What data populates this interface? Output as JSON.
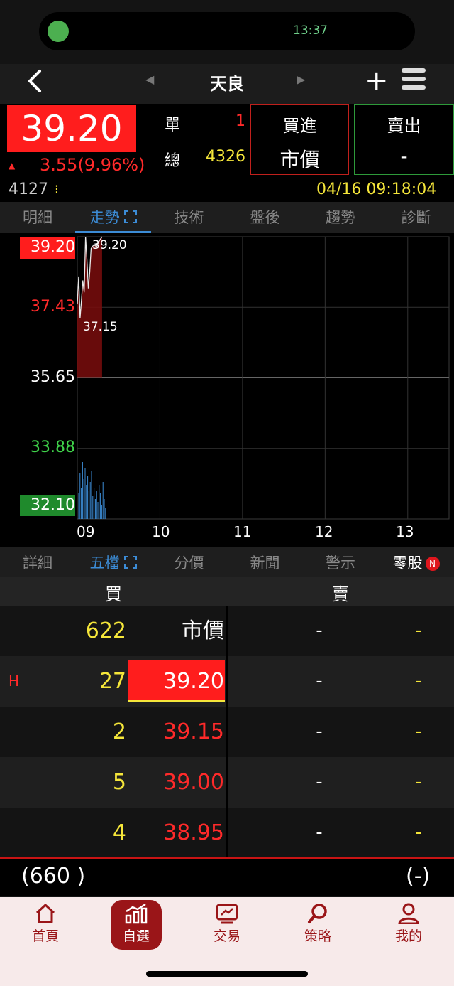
{
  "status": {
    "time": "13:37"
  },
  "nav": {
    "title": "天良"
  },
  "quote": {
    "price": "39.20",
    "change": "3.55(9.96%)",
    "unit_label": "單",
    "unit_value": "1",
    "total_label": "總",
    "total_value": "4326",
    "buy_title": "買進",
    "buy_value": "市價",
    "sell_title": "賣出",
    "sell_value": "-",
    "volume": "4127",
    "datetime": "04/16 09:18:04"
  },
  "top_tabs": [
    "明細",
    "走勢",
    "技術",
    "盤後",
    "趨勢",
    "診斷"
  ],
  "chart_data": {
    "type": "line",
    "y_ticks": [
      "39.20",
      "37.43",
      "35.65",
      "33.88",
      "32.10"
    ],
    "x_ticks": [
      "09",
      "10",
      "11",
      "12",
      "13"
    ],
    "ylim": [
      32.1,
      39.2
    ],
    "annotations": [
      "39.20",
      "37.15"
    ],
    "series": [
      {
        "x": [
          "09:00",
          "09:01",
          "09:02",
          "09:03",
          "09:04",
          "09:05",
          "09:06",
          "09:07",
          "09:08",
          "09:09",
          "09:10",
          "09:12",
          "09:14",
          "09:16",
          "09:18"
        ],
        "values": [
          37.5,
          38.2,
          37.15,
          37.6,
          38.1,
          37.8,
          39.2,
          38.6,
          37.9,
          38.3,
          38.9,
          39.0,
          38.95,
          39.1,
          39.2
        ]
      }
    ],
    "volume": [
      18,
      32,
      22,
      40,
      28,
      36,
      24,
      30,
      20,
      26,
      34,
      16,
      22,
      14,
      20,
      12,
      24,
      18,
      10,
      26,
      14,
      8
    ]
  },
  "bottom_tabs": [
    "詳細",
    "五檔",
    "分價",
    "新聞",
    "警示",
    "零股"
  ],
  "bottom_tab_badge": "N",
  "orderbook": {
    "buy_label": "買",
    "sell_label": "賣",
    "rows": [
      {
        "flag": "",
        "buy_qty": "622",
        "buy_price": "市價",
        "sell_price": "-",
        "sell_qty": "-"
      },
      {
        "flag": "H",
        "buy_qty": "27",
        "buy_price": "39.20",
        "sell_price": "-",
        "sell_qty": "-"
      },
      {
        "flag": "",
        "buy_qty": "2",
        "buy_price": "39.15",
        "sell_price": "-",
        "sell_qty": "-"
      },
      {
        "flag": "",
        "buy_qty": "5",
        "buy_price": "39.00",
        "sell_price": "-",
        "sell_qty": "-"
      },
      {
        "flag": "",
        "buy_qty": "4",
        "buy_price": "38.95",
        "sell_price": "-",
        "sell_qty": "-"
      }
    ],
    "buy_total": "(660 )",
    "sell_total": "(-)"
  },
  "tabbar": [
    {
      "label": "首頁",
      "icon": "home-icon"
    },
    {
      "label": "自選",
      "icon": "chart-icon"
    },
    {
      "label": "交易",
      "icon": "trade-icon"
    },
    {
      "label": "策略",
      "icon": "search-icon"
    },
    {
      "label": "我的",
      "icon": "user-icon"
    }
  ],
  "colors": {
    "up": "#ff2a2a",
    "down": "#3fd24a",
    "accent": "#3c8cd6",
    "brand": "#9a1518"
  }
}
